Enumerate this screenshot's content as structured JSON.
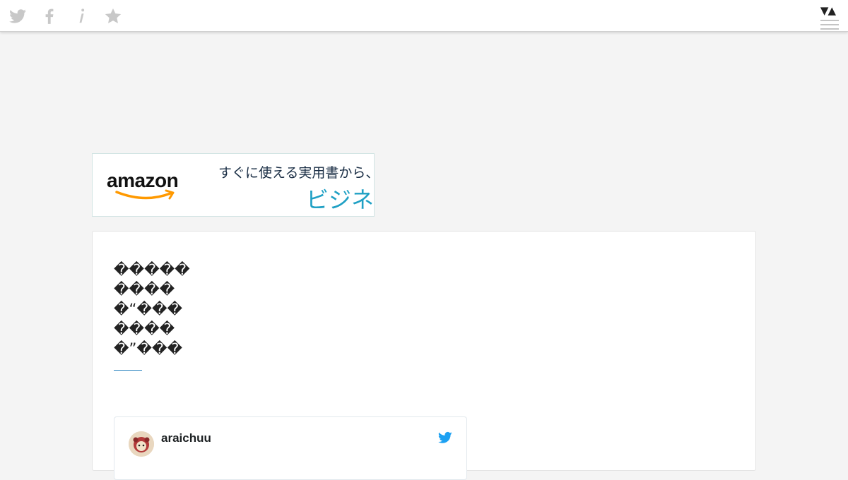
{
  "toolbar": {
    "icons": [
      "twitter-icon",
      "facebook-icon",
      "info-icon",
      "star-icon"
    ],
    "sort_toggle": "▼▲",
    "menu_icon": "hamburger-menu-icon",
    "icon_color": "#c8c8c8"
  },
  "ad": {
    "logo": "amazon",
    "line1": "すぐに使える実用書から、話",
    "line2": "ビジネス",
    "accent": "#ff9900",
    "highlight": "#1fa0c4"
  },
  "article": {
    "title_lines": [
      "�����",
      "����",
      "�“���",
      "����",
      "�”���"
    ],
    "rule_color": "#2e86c1"
  },
  "tweet": {
    "username": "araichuu",
    "brand": "#1da1f2"
  }
}
